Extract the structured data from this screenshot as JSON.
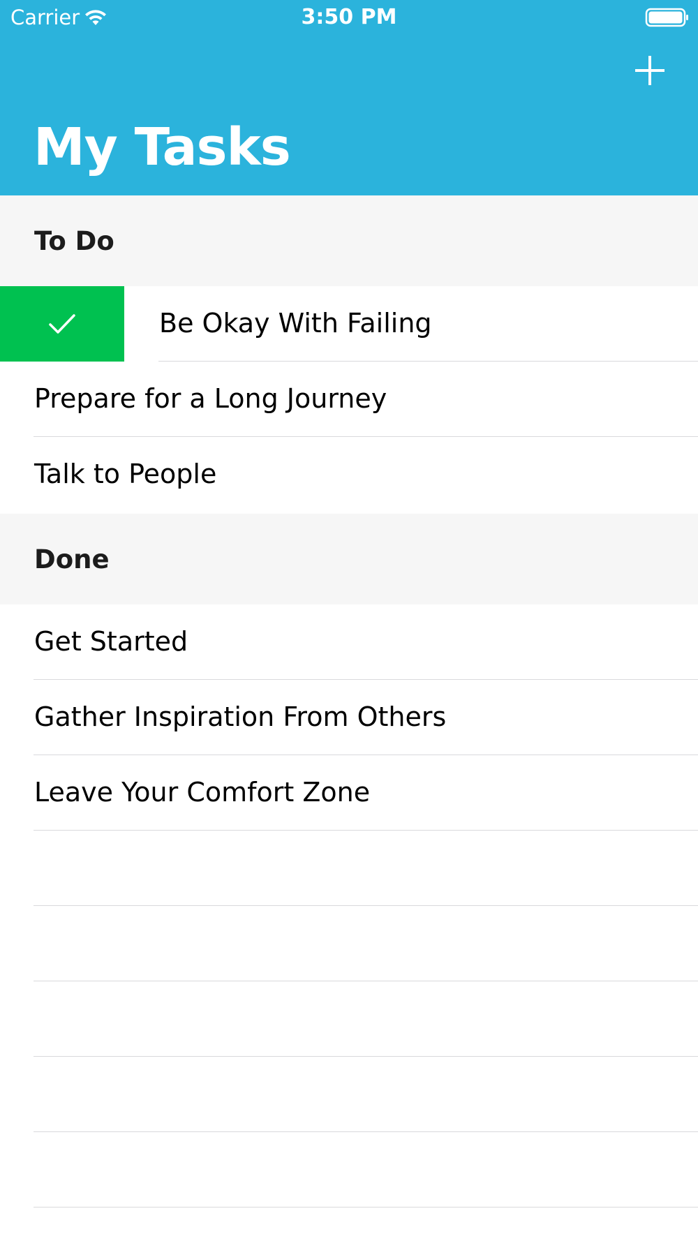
{
  "status_bar": {
    "carrier": "Carrier",
    "time": "3:50 PM",
    "wifi_icon": "wifi-icon",
    "battery_icon": "battery-icon"
  },
  "navigation": {
    "title": "My Tasks",
    "add_icon": "plus-icon",
    "bar_color": "#2bb3dc"
  },
  "sections": [
    {
      "title": "To Do",
      "items": [
        {
          "label": "Be Okay With Failing",
          "swipe_action_icon": "checkmark-icon",
          "swipe_action_color": "#00c150"
        },
        {
          "label": "Prepare for a Long Journey"
        },
        {
          "label": "Talk to People"
        }
      ]
    },
    {
      "title": "Done",
      "items": [
        {
          "label": "Get Started"
        },
        {
          "label": "Gather Inspiration From Others"
        },
        {
          "label": "Leave Your Comfort Zone"
        }
      ]
    }
  ]
}
